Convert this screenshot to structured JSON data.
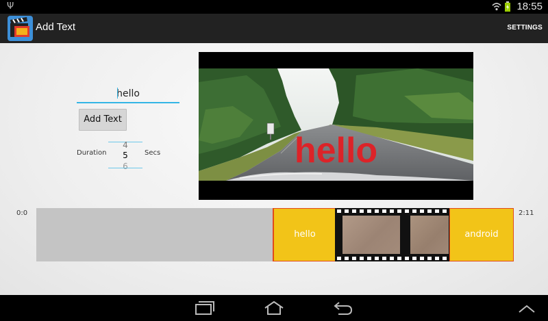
{
  "status_bar": {
    "time": "18:55"
  },
  "action_bar": {
    "title": "Add Text",
    "settings_label": "SETTINGS"
  },
  "editor": {
    "text_value": "hello",
    "add_button_label": "Add Text",
    "duration_label": "Duration",
    "secs_label": "Secs",
    "picker": {
      "prev": "4",
      "current": "5",
      "next": "6"
    }
  },
  "preview": {
    "overlay_text": "hello"
  },
  "timeline": {
    "start_time": "0:0",
    "end_time": "2:11",
    "clips": [
      {
        "type": "text",
        "label": "hello"
      },
      {
        "type": "video",
        "label": ""
      },
      {
        "type": "text",
        "label": "android"
      }
    ]
  },
  "colors": {
    "accent": "#33b5e5",
    "text_clip": "#f2c418",
    "clip_border": "#e04a1a",
    "overlay_text": "#dc2328",
    "empty_track": "#c4c4c4"
  },
  "icons": [
    "usb-icon",
    "wifi-icon",
    "battery-icon",
    "app-icon",
    "recent-apps-icon",
    "home-icon",
    "back-icon",
    "chevron-up-icon"
  ]
}
